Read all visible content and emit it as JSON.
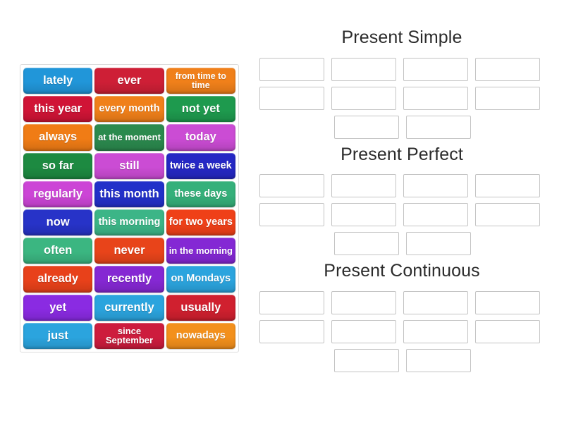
{
  "activity": {
    "type": "group-sort",
    "panel_name": "word-tiles-panel"
  },
  "tiles": [
    {
      "label": "lately",
      "color": "#2196d9",
      "size": "t-lg"
    },
    {
      "label": "ever",
      "color": "#ce1f36",
      "size": "t-lg"
    },
    {
      "label": "from time to time",
      "color": "#f0801a",
      "size": "t-xs"
    },
    {
      "label": "this year",
      "color": "#d01436",
      "size": "t-lg"
    },
    {
      "label": "every month",
      "color": "#f0801a",
      "size": "t-md"
    },
    {
      "label": "not yet",
      "color": "#1e9a4e",
      "size": "t-lg"
    },
    {
      "label": "always",
      "color": "#f07c15",
      "size": "t-lg"
    },
    {
      "label": "at the moment",
      "color": "#2b8a4e",
      "size": "t-sm"
    },
    {
      "label": "today",
      "color": "#c council",
      "size": "t-lg"
    },
    {
      "label": "so far",
      "color": "#1d8a41",
      "size": "t-lg"
    },
    {
      "label": "still",
      "color": "#cb4cd4",
      "size": "t-lg"
    },
    {
      "label": "twice a week",
      "color": "#2528c4",
      "size": "t-md"
    },
    {
      "label": "regularly",
      "color": "#cc45d6",
      "size": "t-lg"
    },
    {
      "label": "this month",
      "color": "#2230c9",
      "size": "t-lg"
    },
    {
      "label": "these days",
      "color": "#35b07a",
      "size": "t-md"
    },
    {
      "label": "now",
      "color": "#2733c8",
      "size": "t-lg"
    },
    {
      "label": "this morning",
      "color": "#3cb587",
      "size": "t-md"
    },
    {
      "label": "for two years",
      "color": "#ef4018",
      "size": "t-md"
    },
    {
      "label": "often",
      "color": "#3bb681",
      "size": "t-lg"
    },
    {
      "label": "never",
      "color": "#e8441a",
      "size": "t-lg"
    },
    {
      "label": "in the morning",
      "color": "#8428d4",
      "size": "t-sm"
    },
    {
      "label": "already",
      "color": "#e8411a",
      "size": "t-lg"
    },
    {
      "label": "recently",
      "color": "#8528d3",
      "size": "t-lg"
    },
    {
      "label": "on Mondays",
      "color": "#2ba4de",
      "size": "t-md"
    },
    {
      "label": "yet",
      "color": "#8a2be2",
      "size": "t-lg"
    },
    {
      "label": "currently",
      "color": "#2ba4de",
      "size": "t-lg"
    },
    {
      "label": "usually",
      "color": "#d0202f",
      "size": "t-lg"
    },
    {
      "label": "just",
      "color": "#2ba4de",
      "size": "t-lg"
    },
    {
      "label": "since September",
      "color": "#cd1c3d",
      "size": "t-sm"
    },
    {
      "label": "nowadays",
      "color": "#f3901c",
      "size": "t-md"
    }
  ],
  "groups": [
    {
      "title": "Present Simple",
      "rows": [
        [
          "",
          "",
          "",
          ""
        ],
        [
          "",
          "",
          "",
          ""
        ],
        [
          "",
          ""
        ]
      ]
    },
    {
      "title": "Present Perfect",
      "rows": [
        [
          "",
          "",
          "",
          ""
        ],
        [
          "",
          "",
          "",
          ""
        ],
        [
          "",
          ""
        ]
      ]
    },
    {
      "title": "Present Continuous",
      "rows": [
        [
          "",
          "",
          "",
          ""
        ],
        [
          "",
          "",
          "",
          ""
        ],
        [
          "",
          ""
        ]
      ]
    }
  ],
  "colors": {
    "page_background": "#ffffff",
    "panel_border": "#dcdcdc",
    "slot_border": "#c4c4c4",
    "title_text": "#2b2b2b",
    "tile_text": "#ffffff"
  }
}
